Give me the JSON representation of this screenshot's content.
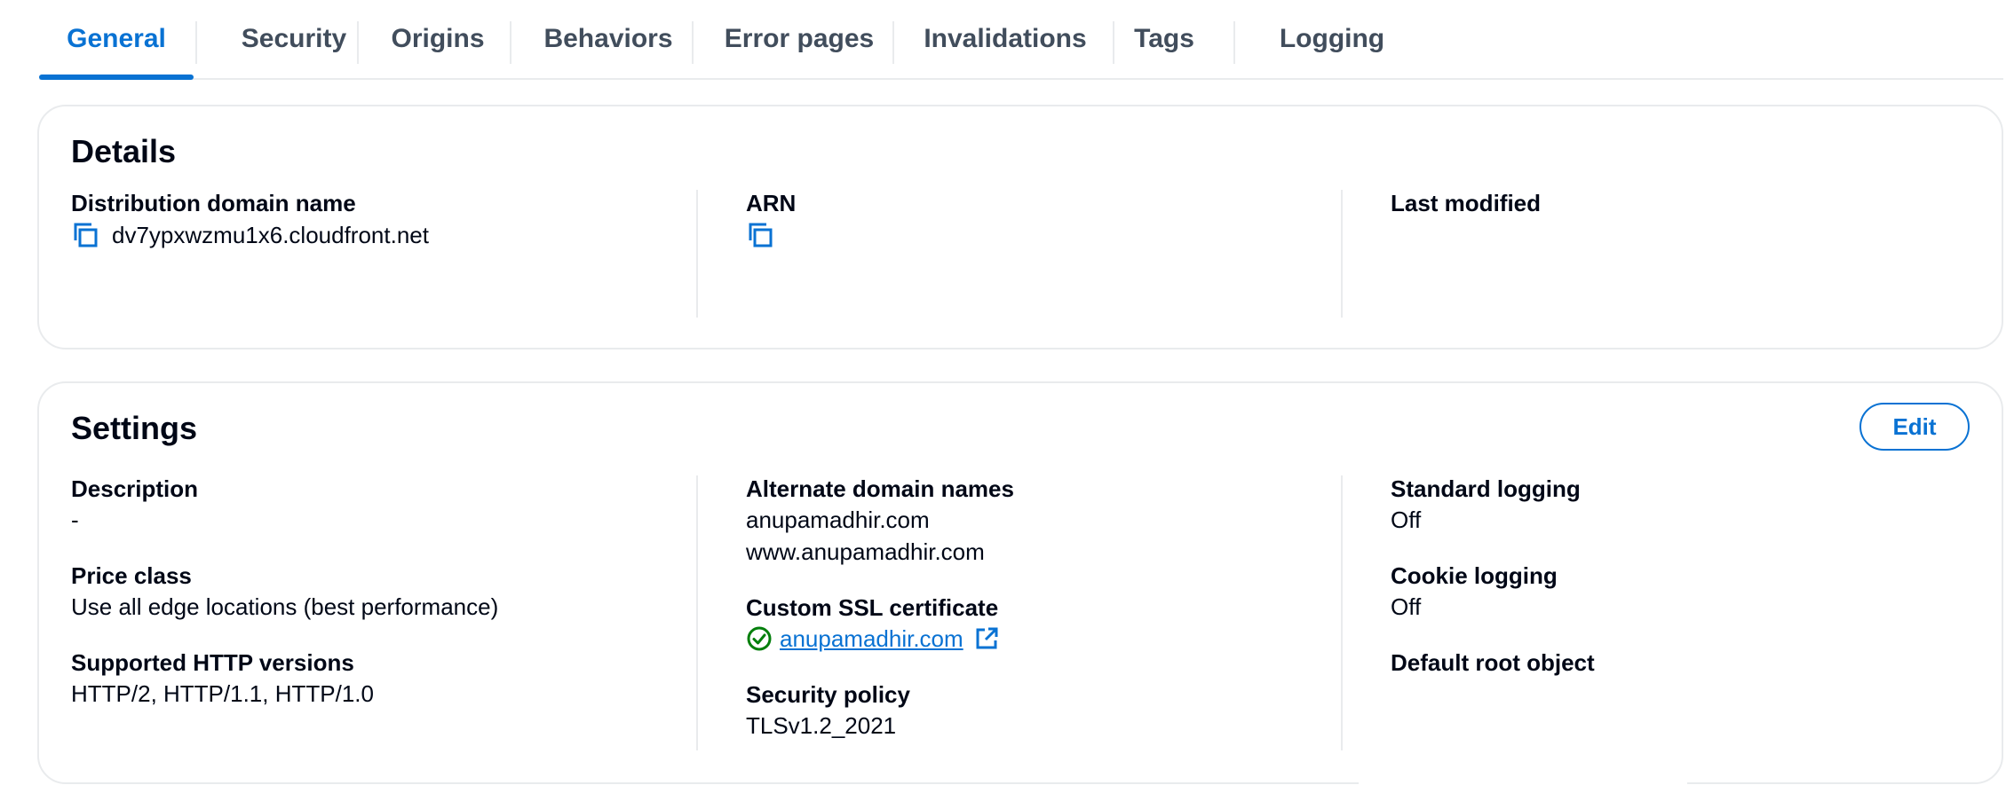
{
  "tabs": [
    {
      "label": "General",
      "active": true
    },
    {
      "label": "Security"
    },
    {
      "label": "Origins"
    },
    {
      "label": "Behaviors"
    },
    {
      "label": "Error pages"
    },
    {
      "label": "Invalidations"
    },
    {
      "label": "Tags"
    },
    {
      "label": "Logging"
    }
  ],
  "details": {
    "title": "Details",
    "distribution_domain": {
      "label": "Distribution domain name",
      "value": "dv7ypxwzmu1x6.cloudfront.net"
    },
    "arn": {
      "label": "ARN",
      "value": ""
    },
    "last_modified": {
      "label": "Last modified",
      "value": ""
    }
  },
  "settings": {
    "title": "Settings",
    "edit_label": "Edit",
    "description": {
      "label": "Description",
      "value": "-"
    },
    "price_class": {
      "label": "Price class",
      "value": "Use all edge locations (best performance)"
    },
    "http_versions": {
      "label": "Supported HTTP versions",
      "value": "HTTP/2, HTTP/1.1, HTTP/1.0"
    },
    "alternate_domains": {
      "label": "Alternate domain names",
      "values": [
        "anupamadhir.com",
        "www.anupamadhir.com"
      ]
    },
    "ssl_certificate": {
      "label": "Custom SSL certificate",
      "value": "anupamadhir.com",
      "status": "valid"
    },
    "security_policy": {
      "label": "Security policy",
      "value": "TLSv1.2_2021"
    },
    "standard_logging": {
      "label": "Standard logging",
      "value": "Off"
    },
    "cookie_logging": {
      "label": "Cookie logging",
      "value": "Off"
    },
    "default_root_object": {
      "label": "Default root object",
      "value": ""
    }
  },
  "icons": {
    "copy": "copy-icon",
    "status_success": "check-circle-icon",
    "external": "external-link-icon"
  },
  "colors": {
    "accent": "#0972d3",
    "success": "#037f0c",
    "border": "#e9ebed",
    "text": "#000716",
    "tab_text": "#414d5c"
  }
}
